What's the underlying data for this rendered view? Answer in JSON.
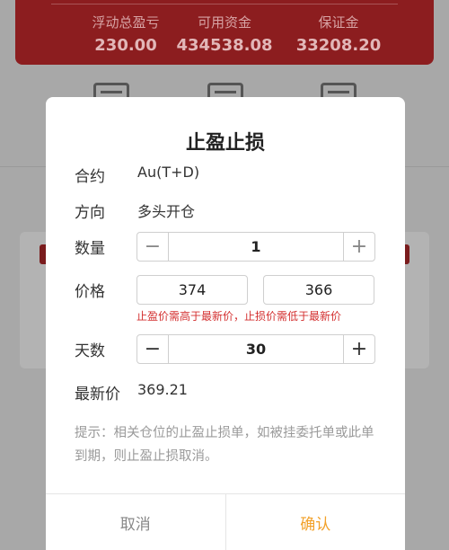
{
  "background": {
    "stats": [
      {
        "label": "浮动总盈亏",
        "value": "230.00"
      },
      {
        "label": "可用资金",
        "value": "434538.08"
      },
      {
        "label": "保证金",
        "value": "33208.20"
      }
    ]
  },
  "dialog": {
    "title": "止盈止损",
    "contract_label": "合约",
    "contract_value": "Au(T+D)",
    "direction_label": "方向",
    "direction_value": "多头开仓",
    "quantity_label": "数量",
    "quantity_value": "1",
    "price_label": "价格",
    "take_profit_price": "374",
    "stop_loss_price": "366",
    "price_hint": "止盈价需高于最新价，止损价需低于最新价",
    "days_label": "天数",
    "days_value": "30",
    "latest_price_label": "最新价",
    "latest_price_value": "369.21",
    "tip": "提示：相关仓位的止盈止损单，如被挂委托单或此单到期，则止盈止损取消。",
    "cancel_label": "取消",
    "confirm_label": "确认",
    "minus_symbol": "−",
    "plus_symbol": "+"
  }
}
